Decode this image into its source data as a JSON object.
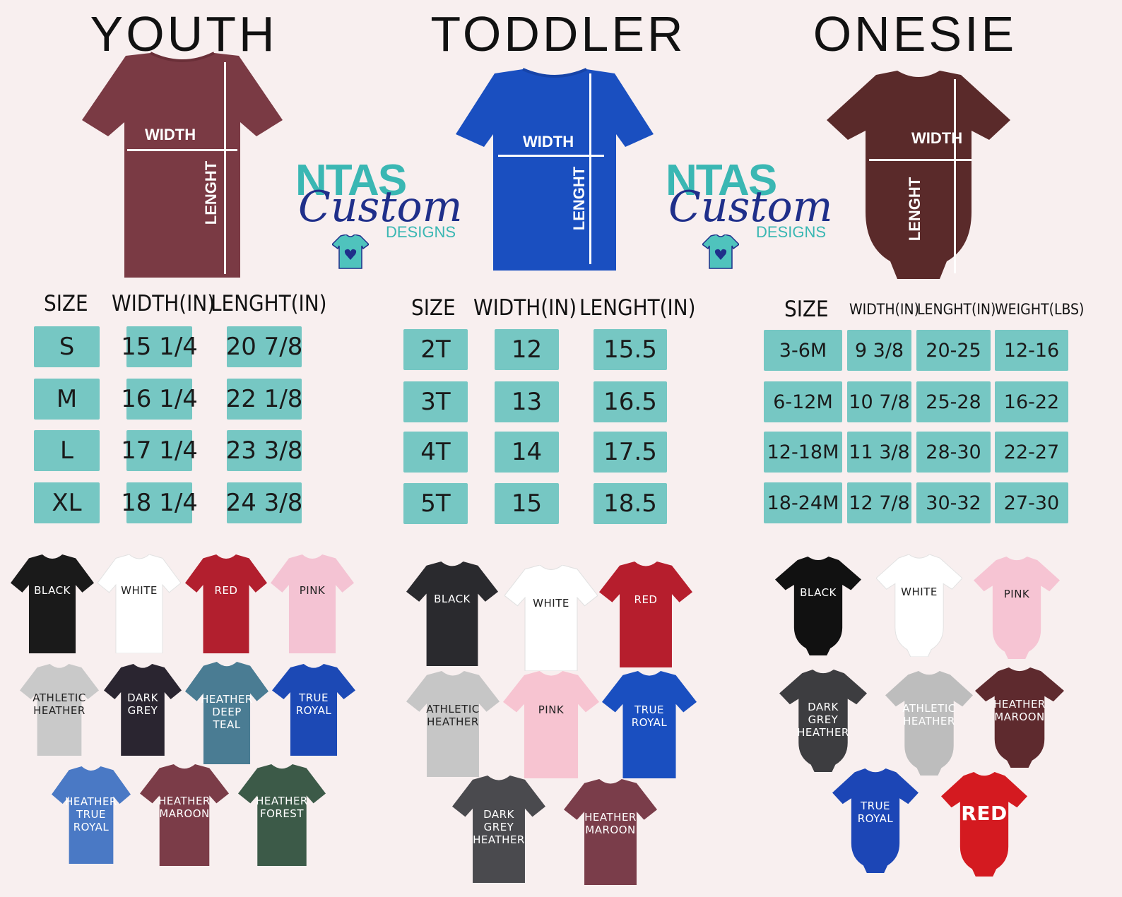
{
  "sections": {
    "youth": {
      "title": "YOUTH",
      "headers": [
        "SIZE",
        "WIDTH(IN)",
        "LENGHT(IN)"
      ],
      "rows": [
        {
          "size": "S",
          "width": "15 1/4",
          "length": "20 7/8"
        },
        {
          "size": "M",
          "width": "16 1/4",
          "length": "22 1/8"
        },
        {
          "size": "L",
          "width": "17 1/4",
          "length": "23 3/8"
        },
        {
          "size": "XL",
          "width": "18 1/4",
          "length": "24 3/8"
        }
      ],
      "colors": [
        "BLACK",
        "WHITE",
        "RED",
        "PINK",
        "ATHLETIC\nHEATHER",
        "DARK\nGREY",
        "HEATHER\nDEEP\nTEAL",
        "TRUE\nROYAL",
        "HEATHER\nTRUE\nROYAL",
        "HEATHER\nMAROON",
        "HEATHER\nFOREST"
      ]
    },
    "toddler": {
      "title": "TODDLER",
      "headers": [
        "SIZE",
        "WIDTH(IN)",
        "LENGHT(IN)"
      ],
      "rows": [
        {
          "size": "2T",
          "width": "12",
          "length": "15.5"
        },
        {
          "size": "3T",
          "width": "13",
          "length": "16.5"
        },
        {
          "size": "4T",
          "width": "14",
          "length": "17.5"
        },
        {
          "size": "5T",
          "width": "15",
          "length": "18.5"
        }
      ],
      "colors": [
        "BLACK",
        "WHITE",
        "RED",
        "ATHLETIC\nHEATHER",
        "PINK",
        "TRUE\nROYAL",
        "DARK\nGREY\nHEATHER",
        "HEATHER\nMAROON"
      ]
    },
    "onesie": {
      "title": "ONESIE",
      "headers": [
        "SIZE",
        "WIDTH(IN)",
        "LENGHT(IN)",
        "WEIGHT(LBS)"
      ],
      "rows": [
        {
          "size": "3-6M",
          "width": "9 3/8",
          "length": "20-25",
          "weight": "12-16"
        },
        {
          "size": "6-12M",
          "width": "10 7/8",
          "length": "25-28",
          "weight": "16-22"
        },
        {
          "size": "12-18M",
          "width": "11 3/8",
          "length": "28-30",
          "weight": "22-27"
        },
        {
          "size": "18-24M",
          "width": "12 7/8",
          "length": "30-32",
          "weight": "27-30"
        }
      ],
      "colors": [
        "BLACK",
        "WHITE",
        "PINK",
        "DARK\nGREY\nHEATHER",
        "ATHLETIC\nHEATHER",
        "HEATHER\nMAROON",
        "TRUE\nROYAL",
        "RED"
      ]
    }
  },
  "measure": {
    "width": "WIDTH",
    "length": "LENGHT"
  },
  "logo": {
    "line1": "NTAS",
    "line2": "Custom",
    "line3": "DESIGNS"
  },
  "palette": {
    "cell": "#76c7c3",
    "bg": "#f8efef",
    "maroon": "#7a3a44",
    "royal": "#1a4fc0",
    "brown": "#5a2a2a"
  }
}
